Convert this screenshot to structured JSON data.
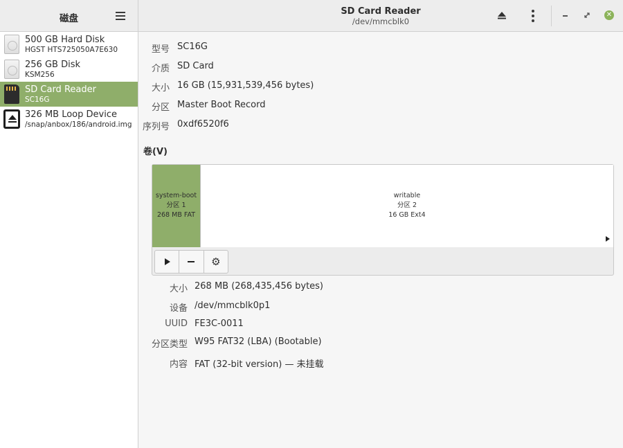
{
  "sidebar": {
    "title": "磁盘",
    "drives": [
      {
        "name": "500 GB Hard Disk",
        "sub": "HGST HTS725050A7E630",
        "icon": "hard-disk-icon"
      },
      {
        "name": "256 GB Disk",
        "sub": "KSM256",
        "icon": "hard-disk-icon"
      },
      {
        "name": "SD Card Reader",
        "sub": "SC16G",
        "icon": "sd-card-icon",
        "selected": true
      },
      {
        "name": "326 MB Loop Device",
        "sub": "/snap/anbox/186/android.img",
        "icon": "loop-device-icon"
      }
    ]
  },
  "header": {
    "title": "SD Card Reader",
    "subtitle": "/dev/mmcblk0",
    "close_glyph": "✕"
  },
  "device": {
    "model_label": "型号",
    "model": "SC16G",
    "media_label": "介质",
    "media": "SD Card",
    "size_label": "大小",
    "size": "16 GB (15,931,539,456 bytes)",
    "partitioning_label": "分区",
    "partitioning": "Master Boot Record",
    "serial_label": "序列号",
    "serial": "0xdf6520f6"
  },
  "volumes": {
    "heading": "卷(V)",
    "segments": [
      {
        "name": "system-boot",
        "part": "分区 1",
        "info": "268 MB FAT"
      },
      {
        "name": "writable",
        "part": "分区 2",
        "info": "16 GB Ext4"
      }
    ],
    "gear_glyph": "⚙"
  },
  "partition": {
    "size_label": "大小",
    "size": "268 MB (268,435,456 bytes)",
    "device_label": "设备",
    "device": "/dev/mmcblk0p1",
    "uuid_label": "UUID",
    "uuid": "FE3C-0011",
    "type_label": "分区类型",
    "type": "W95 FAT32 (LBA) (Bootable)",
    "contents_label": "内容",
    "contents": "FAT (32-bit version) — 未挂载"
  },
  "colors": {
    "accent": "#8fae6a",
    "close": "#8cb35a"
  }
}
